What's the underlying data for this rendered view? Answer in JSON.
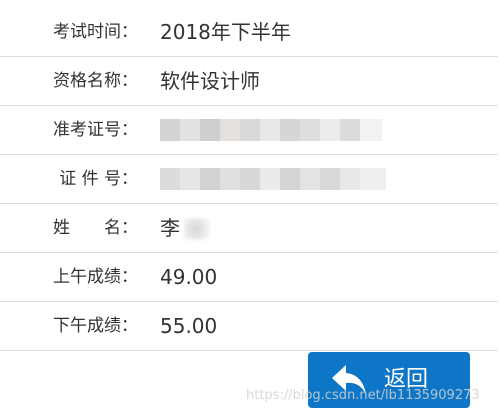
{
  "result": {
    "rows": [
      {
        "label": "考试时间：",
        "value": "2018年下半年"
      },
      {
        "label": "资格名称：",
        "value": "软件设计师"
      },
      {
        "label": "准考证号：",
        "value": ""
      },
      {
        "label": "证 件 号：",
        "value": ""
      },
      {
        "label": "姓　　名：",
        "value": "李"
      },
      {
        "label": "上午成绩：",
        "value": "49.00"
      },
      {
        "label": "下午成绩：",
        "value": "55.00"
      }
    ]
  },
  "actions": {
    "back_label": "返回",
    "back_icon": "undo-arrow-icon"
  },
  "watermark": "https://blog.csdn.net/lb1135909273",
  "colors": {
    "button": "#0e76c7",
    "divider": "#dedede",
    "text": "#333333"
  }
}
